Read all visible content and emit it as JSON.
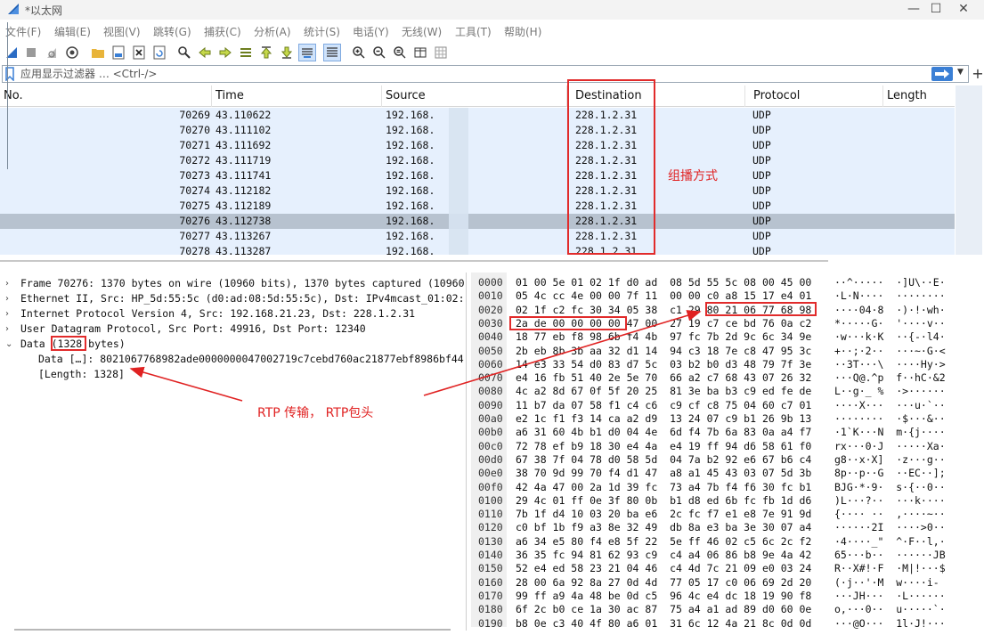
{
  "window": {
    "title": "*以太网"
  },
  "menu": [
    "文件(F)",
    "编辑(E)",
    "视图(V)",
    "跳转(G)",
    "捕获(C)",
    "分析(A)",
    "统计(S)",
    "电话(Y)",
    "无线(W)",
    "工具(T)",
    "帮助(H)"
  ],
  "toolbar": {
    "icons": [
      "shark-fin-start-icon",
      "stop-capture-icon",
      "restart-capture-icon",
      "capture-options-icon",
      "open-file-icon",
      "save-file-icon",
      "close-file-icon",
      "reload-file-icon",
      "find-packet-icon",
      "go-back-icon",
      "go-forward-icon",
      "go-to-packet-icon",
      "go-first-icon",
      "go-last-icon",
      "auto-scroll-icon",
      "colorize-icon",
      "zoom-in-icon",
      "zoom-out-icon",
      "normal-size-icon",
      "resize-columns-icon",
      "layout-icon"
    ]
  },
  "filter": {
    "placeholder": "应用显示过滤器 … <Ctrl-/>",
    "value": ""
  },
  "packet_list": {
    "columns": [
      "No.",
      "Time",
      "Source",
      "Destination",
      "Protocol",
      "Length"
    ],
    "rows": [
      {
        "no": "70269",
        "time": "43.110622",
        "src": "192.168.",
        "dst": "228.1.2.31",
        "proto": "UDP"
      },
      {
        "no": "70270",
        "time": "43.111102",
        "src": "192.168.",
        "dst": "228.1.2.31",
        "proto": "UDP"
      },
      {
        "no": "70271",
        "time": "43.111692",
        "src": "192.168.",
        "dst": "228.1.2.31",
        "proto": "UDP"
      },
      {
        "no": "70272",
        "time": "43.111719",
        "src": "192.168.",
        "dst": "228.1.2.31",
        "proto": "UDP"
      },
      {
        "no": "70273",
        "time": "43.111741",
        "src": "192.168.",
        "dst": "228.1.2.31",
        "proto": "UDP"
      },
      {
        "no": "70274",
        "time": "43.112182",
        "src": "192.168.",
        "dst": "228.1.2.31",
        "proto": "UDP"
      },
      {
        "no": "70275",
        "time": "43.112189",
        "src": "192.168.",
        "dst": "228.1.2.31",
        "proto": "UDP"
      },
      {
        "no": "70276",
        "time": "43.112738",
        "src": "192.168.",
        "dst": "228.1.2.31",
        "proto": "UDP",
        "selected": true
      },
      {
        "no": "70277",
        "time": "43.113267",
        "src": "192.168.",
        "dst": "228.1.2.31",
        "proto": "UDP"
      },
      {
        "no": "70278",
        "time": "43.113287",
        "src": "192.168.",
        "dst": "228.1.2.31",
        "proto": "UDP"
      }
    ]
  },
  "annotations": {
    "multicast_note": "组播方式",
    "rtp_note": "RTP 传输， RTP包头",
    "color": "#e02222"
  },
  "details": [
    {
      "text": "Frame 70276: 1370 bytes on wire (10960 bits), 1370 bytes captured (10960",
      "expanded": false
    },
    {
      "text": "Ethernet II, Src: HP_5d:55:5c (d0:ad:08:5d:55:5c), Dst: IPv4mcast_01:02:",
      "expanded": false
    },
    {
      "text": "Internet Protocol Version 4, Src: 192.168.21.23, Dst: 228.1.2.31",
      "expanded": false
    },
    {
      "text": "User Datagram Protocol, Src Port: 49916, Dst Port: 12340",
      "expanded": false
    },
    {
      "text": "Data (1328 bytes)",
      "expanded": true
    },
    {
      "text": "Data […]: 8021067768982ade0000000047002719c7cebd760ac21877ebf8986bf44",
      "sub": true
    },
    {
      "text": "[Length: 1328]",
      "sub": true
    }
  ],
  "bytes": [
    {
      "off": "0000",
      "hex": "01 00 5e 01 02 1f d0 ad  08 5d 55 5c 08 00 45 00",
      "asc": "··^·····  ·]U\\··E·"
    },
    {
      "off": "0010",
      "hex": "05 4c cc 4e 00 00 7f 11  00 00 c0 a8 15 17 e4 01",
      "asc": "·L·N····  ········"
    },
    {
      "off": "0020",
      "hex": "02 1f c2 fc 30 34 05 38  c1 29 80 21 06 77 68 98",
      "asc": "····04·8  ·)·!·wh·"
    },
    {
      "off": "0030",
      "hex": "2a de 00 00 00 00 47 00  27 19 c7 ce bd 76 0a c2",
      "asc": "*·····G·  '····v··"
    },
    {
      "off": "0040",
      "hex": "18 77 eb f8 98 6b f4 4b  97 fc 7b 2d 9c 6c 34 9e",
      "asc": "·w···k·K  ··{-·l4·"
    },
    {
      "off": "0050",
      "hex": "2b eb 8b 3b aa 32 d1 14  94 c3 18 7e c8 47 95 3c",
      "asc": "+··;·2··  ···~·G·<"
    },
    {
      "off": "0060",
      "hex": "14 e3 33 54 d0 83 d7 5c  03 b2 b0 d3 48 79 7f 3e",
      "asc": "··3T···\\  ····Hy·>"
    },
    {
      "off": "0070",
      "hex": "e4 16 fb 51 40 2e 5e 70  66 a2 c7 68 43 07 26 32",
      "asc": "···Q@.^p  f··hC·&2"
    },
    {
      "off": "0080",
      "hex": "4c a2 8d 67 0f 5f 20 25  81 3e ba b3 c9 ed fe de",
      "asc": "L··g·_ %  ·>······"
    },
    {
      "off": "0090",
      "hex": "11 b7 da 07 58 f1 c4 c6  c9 cf c8 75 04 60 c7 01",
      "asc": "····X···  ···u·`··"
    },
    {
      "off": "00a0",
      "hex": "e2 1c f1 f3 14 ca a2 d9  13 24 07 c9 b1 26 9b 13",
      "asc": "········  ·$···&··"
    },
    {
      "off": "00b0",
      "hex": "a6 31 60 4b b1 d0 04 4e  6d f4 7b 6a 83 0a a4 f7",
      "asc": "·1`K···N  m·{j····"
    },
    {
      "off": "00c0",
      "hex": "72 78 ef b9 18 30 e4 4a  e4 19 ff 94 d6 58 61 f0",
      "asc": "rx···0·J  ·····Xa·"
    },
    {
      "off": "00d0",
      "hex": "67 38 7f 04 78 d0 58 5d  04 7a b2 92 e6 67 b6 c4",
      "asc": "g8··x·X]  ·z···g··"
    },
    {
      "off": "00e0",
      "hex": "38 70 9d 99 70 f4 d1 47  a8 a1 45 43 03 07 5d 3b",
      "asc": "8p··p··G  ··EC··];"
    },
    {
      "off": "00f0",
      "hex": "42 4a 47 00 2a 1d 39 fc  73 a4 7b f4 f6 30 fc b1",
      "asc": "BJG·*·9·  s·{··0··"
    },
    {
      "off": "0100",
      "hex": "29 4c 01 ff 0e 3f 80 0b  b1 d8 ed 6b fc fb 1d d6",
      "asc": ")L···?··  ···k····"
    },
    {
      "off": "0110",
      "hex": "7b 1f d4 10 03 20 ba e6  2c fc f7 e1 e8 7e 91 9d",
      "asc": "{···· ··  ,····~··"
    },
    {
      "off": "0120",
      "hex": "c0 bf 1b f9 a3 8e 32 49  db 8a e3 ba 3e 30 07 a4",
      "asc": "······2I  ····>0··"
    },
    {
      "off": "0130",
      "hex": "a6 34 e5 80 f4 e8 5f 22  5e ff 46 02 c5 6c 2c f2",
      "asc": "·4····_\"  ^·F··l,·"
    },
    {
      "off": "0140",
      "hex": "36 35 fc 94 81 62 93 c9  c4 a4 06 86 b8 9e 4a 42",
      "asc": "65···b··  ······JB"
    },
    {
      "off": "0150",
      "hex": "52 e4 ed 58 23 21 04 46  c4 4d 7c 21 09 e0 03 24",
      "asc": "R··X#!·F  ·M|!···$"
    },
    {
      "off": "0160",
      "hex": "28 00 6a 92 8a 27 0d 4d  77 05 17 c0 06 69 2d 20",
      "asc": "(·j··'·M  w····i- "
    },
    {
      "off": "0170",
      "hex": "99 ff a9 4a 48 be 0d c5  96 4c e4 dc 18 19 90 f8",
      "asc": "···JH···  ·L······"
    },
    {
      "off": "0180",
      "hex": "6f 2c b0 ce 1a 30 ac 87  75 a4 a1 ad 89 d0 60 0e",
      "asc": "o,···0··  u·····`·"
    },
    {
      "off": "0190",
      "hex": "b8 0e c3 40 4f 80 a6 01  31 6c 12 4a 21 8c 0d 0d",
      "asc": "···@O···  1l·J!···"
    }
  ],
  "colors": {
    "row_bg": "#e6f0fd",
    "row_selected": "#b7c2cf",
    "annotation": "#e12b2b",
    "accent": "#3a7fd5"
  }
}
